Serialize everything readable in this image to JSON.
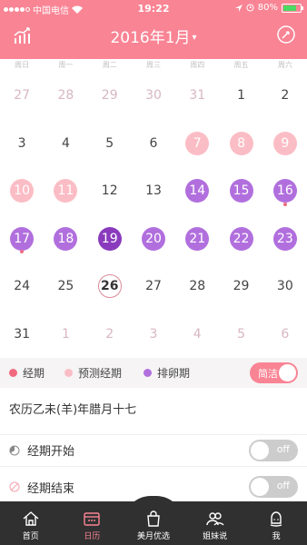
{
  "status_bar": {
    "carrier": "中国电信",
    "time": "19:22",
    "battery": "80%"
  },
  "header": {
    "title": "2016年1月",
    "caret": "▾",
    "left_icon": "stats-chart-icon",
    "right_icon": "compass-icon"
  },
  "weekdays": [
    "周日",
    "周一",
    "周二",
    "周三",
    "周四",
    "周五",
    "周六"
  ],
  "calendar": [
    [
      {
        "d": "27",
        "t": "other"
      },
      {
        "d": "28",
        "t": "other"
      },
      {
        "d": "29",
        "t": "other"
      },
      {
        "d": "30",
        "t": "other"
      },
      {
        "d": "31",
        "t": "other"
      },
      {
        "d": "1",
        "t": "normal"
      },
      {
        "d": "2",
        "t": "normal"
      }
    ],
    [
      {
        "d": "3",
        "t": "normal"
      },
      {
        "d": "4",
        "t": "normal"
      },
      {
        "d": "5",
        "t": "normal"
      },
      {
        "d": "6",
        "t": "normal"
      },
      {
        "d": "7",
        "t": "predict"
      },
      {
        "d": "8",
        "t": "predict"
      },
      {
        "d": "9",
        "t": "predict"
      }
    ],
    [
      {
        "d": "10",
        "t": "predict"
      },
      {
        "d": "11",
        "t": "predict"
      },
      {
        "d": "12",
        "t": "normal"
      },
      {
        "d": "13",
        "t": "normal"
      },
      {
        "d": "14",
        "t": "ovul"
      },
      {
        "d": "15",
        "t": "ovul"
      },
      {
        "d": "16",
        "t": "ovul",
        "marker": true
      }
    ],
    [
      {
        "d": "17",
        "t": "ovul",
        "marker": true
      },
      {
        "d": "18",
        "t": "ovul"
      },
      {
        "d": "19",
        "t": "peak"
      },
      {
        "d": "20",
        "t": "ovul"
      },
      {
        "d": "21",
        "t": "ovul"
      },
      {
        "d": "22",
        "t": "ovul"
      },
      {
        "d": "23",
        "t": "ovul"
      }
    ],
    [
      {
        "d": "24",
        "t": "normal"
      },
      {
        "d": "25",
        "t": "normal"
      },
      {
        "d": "26",
        "t": "today"
      },
      {
        "d": "27",
        "t": "normal"
      },
      {
        "d": "28",
        "t": "normal"
      },
      {
        "d": "29",
        "t": "normal"
      },
      {
        "d": "30",
        "t": "normal"
      }
    ],
    [
      {
        "d": "31",
        "t": "normal"
      },
      {
        "d": "1",
        "t": "other"
      },
      {
        "d": "2",
        "t": "other"
      },
      {
        "d": "3",
        "t": "other"
      },
      {
        "d": "4",
        "t": "other"
      },
      {
        "d": "5",
        "t": "other"
      },
      {
        "d": "6",
        "t": "other"
      }
    ]
  ],
  "legend": {
    "period": "经期",
    "predicted": "预测经期",
    "ovulation": "排卵期",
    "simple_toggle": "简洁"
  },
  "colors": {
    "brand": "#f98494",
    "period": "#f06b80",
    "predicted": "#fbbdc5",
    "ovulation": "#b16fde",
    "ovulation_peak": "#8a3bbd"
  },
  "lunar_date": "农历乙未(羊)年腊月十七",
  "settings": {
    "period_start": {
      "label": "经期开始",
      "state": "off"
    },
    "period_end": {
      "label": "经期结束",
      "state": "off"
    }
  },
  "bottom_nav": {
    "home": "首页",
    "calendar": "日历",
    "shop": "美月优选",
    "sisters": "姐妹说",
    "me": "我"
  }
}
